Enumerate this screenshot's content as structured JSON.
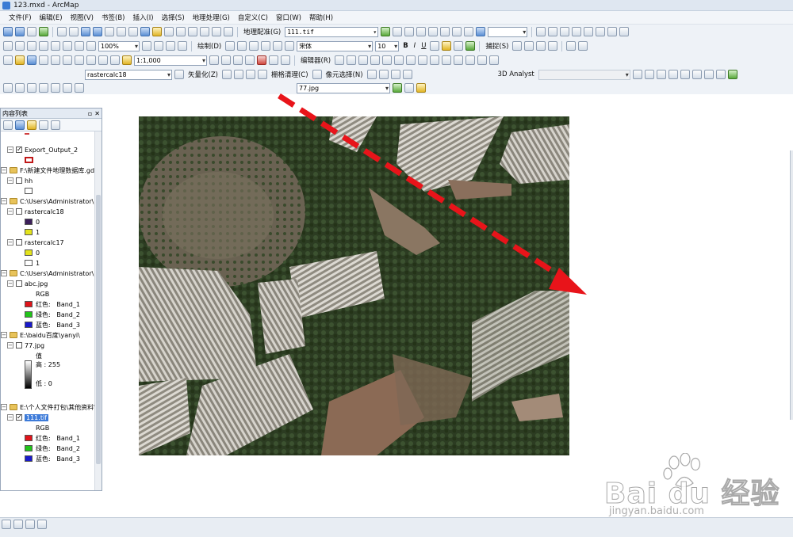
{
  "window": {
    "title": "123.mxd - ArcMap"
  },
  "menu": [
    "文件(F)",
    "编辑(E)",
    "视图(V)",
    "书签(B)",
    "插入(I)",
    "选择(S)",
    "地理处理(G)",
    "自定义(C)",
    "窗口(W)",
    "帮助(H)"
  ],
  "toolbars": {
    "georef_label": "地理配准(G)",
    "georef_layer": "111.tif",
    "draw_label": "绘制(D)",
    "font_name": "宋体",
    "font_size": "10",
    "bold": "B",
    "italic": "I",
    "underline": "U",
    "zoom_percent": "100%",
    "map_scale": "1:1,000",
    "editor_label": "编辑器(R)",
    "capture_label": "捕捉(S)",
    "raster_layer": "rastercalc18",
    "vectorize_label": "矢量化(Z)",
    "raster_cleanup_label": "栅格清理(C)",
    "cell_select_label": "像元选择(N)",
    "analyst_3d_label": "3D Analyst",
    "layer_combo": "77.jpg"
  },
  "toc": {
    "title": "内容列表",
    "items": [
      {
        "label": "Export_Output_2"
      },
      {
        "label": "F:\\新建文件地理数据库.gdb"
      },
      {
        "label": "hh"
      },
      {
        "label": "C:\\Users\\Administrator\\D"
      },
      {
        "label": "rastercalc18"
      },
      {
        "label": "0"
      },
      {
        "label": "1"
      },
      {
        "label": "rastercalc17"
      },
      {
        "label": "0"
      },
      {
        "label": "1"
      },
      {
        "label": "C:\\Users\\Administrator\\D"
      },
      {
        "label": "abc.jpg"
      },
      {
        "label": "RGB"
      },
      {
        "label": "红色:",
        "value": "Band_1"
      },
      {
        "label": "绿色:",
        "value": "Band_2"
      },
      {
        "label": "蓝色:",
        "value": "Band_3"
      },
      {
        "label": "E:\\baidu百度\\yanyi\\"
      },
      {
        "label": "77.jpg"
      },
      {
        "label": "值"
      },
      {
        "label": "高 : 255"
      },
      {
        "label": "低 : 0"
      },
      {
        "label": "E:\\个人文件打包\\其他资料\\"
      },
      {
        "label": "111.tif"
      },
      {
        "label": "RGB"
      },
      {
        "label": "红色:",
        "value": "Band_1"
      },
      {
        "label": "绿色:",
        "value": "Band_2"
      },
      {
        "label": "蓝色:",
        "value": "Band_3"
      }
    ]
  },
  "colors": {
    "arrow": "#e8141a",
    "band_red": "#e0141a",
    "band_green": "#22c41a",
    "band_blue": "#1a1acb",
    "class_purple": "#3c1f5a",
    "class_yellow": "#e3e31c",
    "selection": "#3d7bd9"
  },
  "watermark": {
    "brand": "Bai du 经验",
    "url": "jingyan.baidu.com"
  }
}
